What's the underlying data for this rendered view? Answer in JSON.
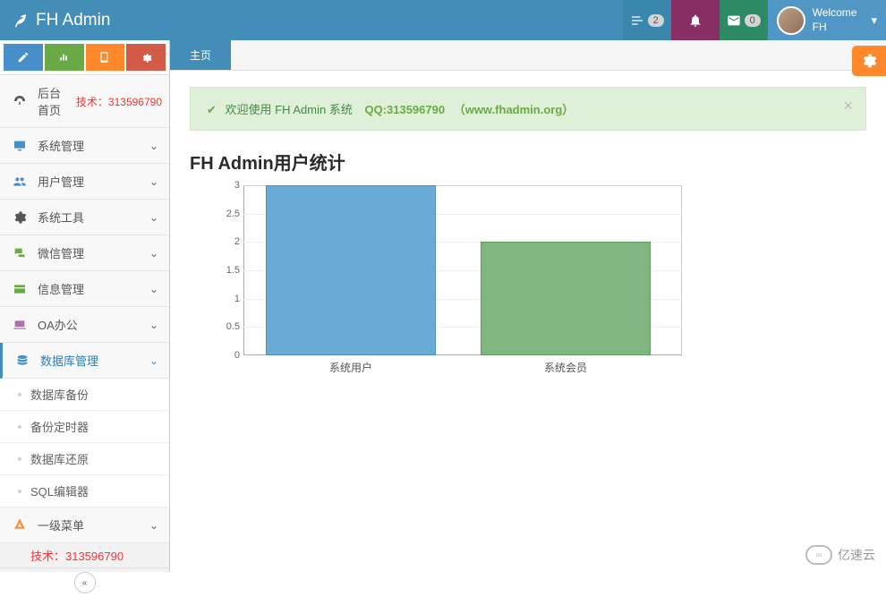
{
  "header": {
    "brand": "FH Admin",
    "tasks_badge": "2",
    "mail_badge": "0",
    "welcome": "Welcome",
    "username": "FH"
  },
  "sidebar": {
    "home": "后台首页",
    "tech_prefix": "技术：",
    "tech_number": "313596790",
    "items": [
      {
        "icon": "desktop",
        "label": "系统管理"
      },
      {
        "icon": "users",
        "label": "用户管理"
      },
      {
        "icon": "gear",
        "label": "系统工具"
      },
      {
        "icon": "comments",
        "label": "微信管理"
      },
      {
        "icon": "card",
        "label": "信息管理"
      },
      {
        "icon": "laptop",
        "label": "OA办公"
      },
      {
        "icon": "database",
        "label": "数据库管理"
      }
    ],
    "db_submenu": [
      "数据库备份",
      "备份定时器",
      "数据库还原",
      "SQL编辑器"
    ],
    "level1": "一级菜单",
    "tech_bottom": "技术：313596790"
  },
  "main": {
    "tab": "主页",
    "alert_text": "欢迎使用 FH Admin 系统",
    "alert_qq": "QQ:313596790",
    "alert_link": "（www.fhadmin.org）",
    "chart_title": "FH Admin用户统计"
  },
  "chart_data": {
    "type": "bar",
    "categories": [
      "系统用户",
      "系统会员"
    ],
    "values": [
      3,
      2
    ],
    "ylim": [
      0,
      3
    ],
    "ystep": 0.5,
    "colors": [
      "#6aaad6",
      "#7fb57f"
    ]
  },
  "watermark": "亿速云"
}
